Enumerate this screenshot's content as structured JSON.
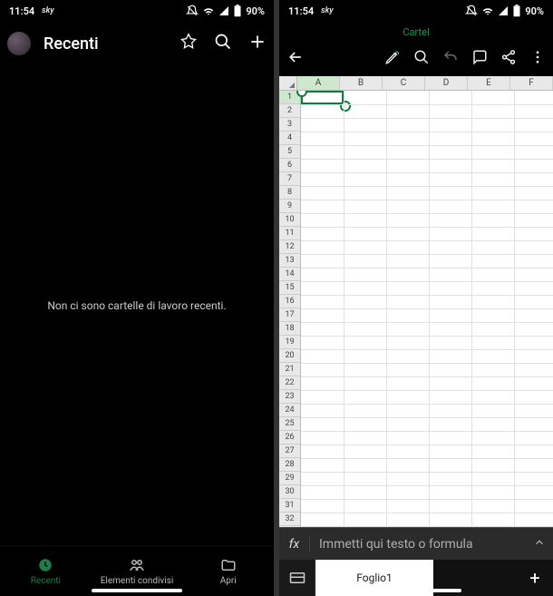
{
  "status": {
    "time": "11:54",
    "carrier": "sky",
    "battery": "90%"
  },
  "left": {
    "title": "Recenti",
    "empty_message": "Non ci sono cartelle di lavoro recenti.",
    "nav": {
      "recent": "Recenti",
      "shared": "Elementi condivisi",
      "open": "Apri"
    }
  },
  "right": {
    "doc_title": "Cartel",
    "columns": [
      "A",
      "B",
      "C",
      "D",
      "E",
      "F"
    ],
    "row_count": 32,
    "selected_cell": {
      "col": 0,
      "row": 0
    },
    "formula": {
      "fx_label": "fx",
      "placeholder": "Immetti qui testo o formula"
    },
    "sheet_tab": "Foglio1"
  }
}
